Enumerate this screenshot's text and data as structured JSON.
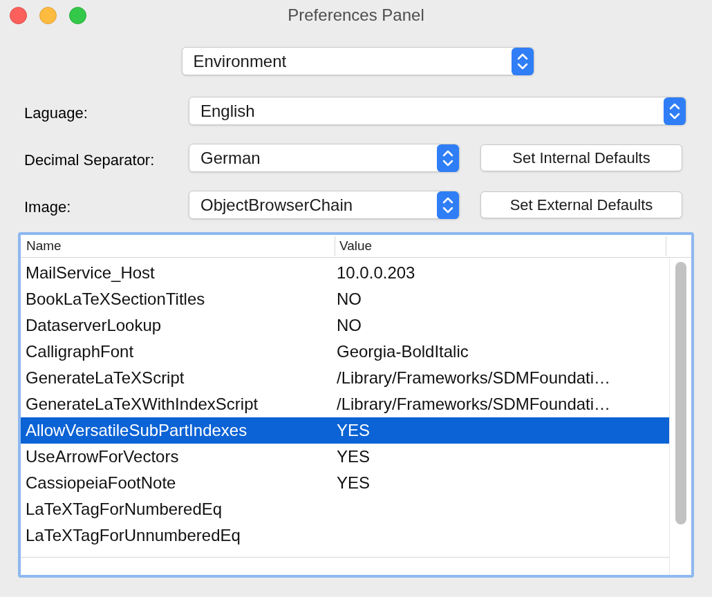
{
  "window": {
    "title": "Preferences Panel"
  },
  "category_popup": {
    "value": "Environment"
  },
  "fields": [
    {
      "label": "Laguage:",
      "value": "English"
    },
    {
      "label": "Decimal Separator:",
      "value": "German",
      "button": "Set Internal Defaults"
    },
    {
      "label": "Image:",
      "value": "ObjectBrowserChain",
      "button": "Set External Defaults"
    }
  ],
  "table": {
    "columns": [
      "Name",
      "Value"
    ],
    "rows": [
      {
        "name": "MailService_Host",
        "value": "10.0.0.203",
        "selected": false
      },
      {
        "name": "BookLaTeXSectionTitles",
        "value": "NO",
        "selected": false
      },
      {
        "name": "DataserverLookup",
        "value": "NO",
        "selected": false
      },
      {
        "name": "CalligraphFont",
        "value": "Georgia-BoldItalic",
        "selected": false
      },
      {
        "name": "GenerateLaTeXScript",
        "value": "/Library/Frameworks/SDMFoundati…",
        "selected": false
      },
      {
        "name": "GenerateLaTeXWithIndexScript",
        "value": "/Library/Frameworks/SDMFoundati…",
        "selected": false
      },
      {
        "name": "AllowVersatileSubPartIndexes",
        "value": "YES",
        "selected": true
      },
      {
        "name": "UseArrowForVectors",
        "value": "YES",
        "selected": false
      },
      {
        "name": "CassiopeiaFootNote",
        "value": "YES",
        "selected": false
      },
      {
        "name": "LaTeXTagForNumberedEq",
        "selected": false
      },
      {
        "name": "LaTeXTagForUnnumberedEq",
        "selected": false
      }
    ]
  }
}
